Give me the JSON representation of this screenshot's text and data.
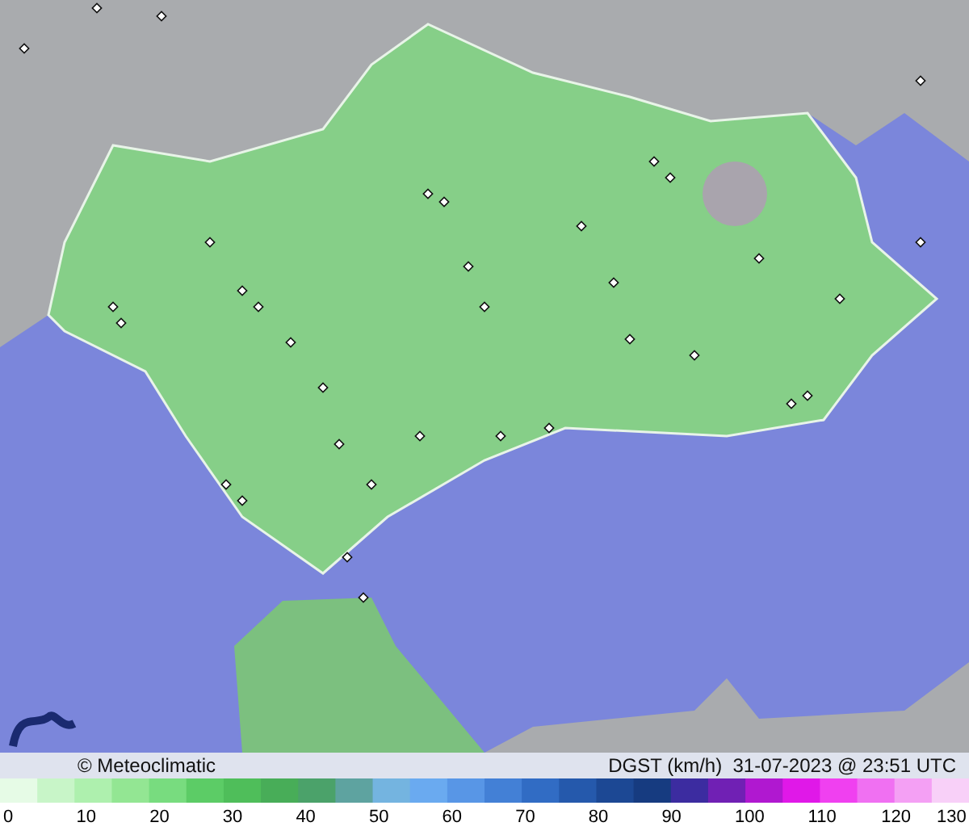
{
  "credit": "© Meteoclimatic",
  "caption": "DGST (km/h)  31-07-2023 @ 23:51 UTC",
  "scale_labels": [
    "0",
    "10",
    "20",
    "30",
    "40",
    "50",
    "60",
    "70",
    "80",
    "90",
    "100",
    "110",
    "120",
    "130"
  ]
}
